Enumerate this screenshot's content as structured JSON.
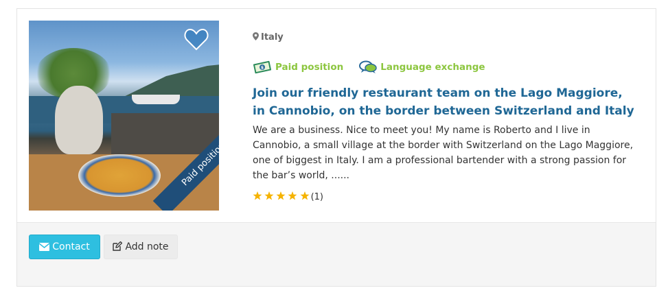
{
  "listing": {
    "location": "Italy",
    "badges": [
      {
        "label": "Paid position",
        "icon": "money-icon"
      },
      {
        "label": "Language exchange",
        "icon": "chat-bubbles-icon"
      }
    ],
    "title": "Join our friendly restaurant team on the Lago Maggiore, in Cannobio, on the border between Switzerland and Italy",
    "description": "We are a business. Nice to meet you! My name is Roberto and I live in Cannobio, a small village at the border with Switzerland on the Lago Maggiore, one of biggest in Italy. I am a professional bartender with a strong passion for the bar’s world, ......",
    "rating": {
      "stars": 5,
      "count": "(1)"
    },
    "ribbon": "Paid position",
    "favorite_icon": "heart-icon",
    "photo": "listing-photo"
  },
  "actions": {
    "contact_label": "Contact",
    "note_label": "Add note"
  },
  "colors": {
    "title": "#1f6795",
    "badge": "#8cc63f",
    "contact_button": "#2ebfe0",
    "ribbon": "#1f4e79",
    "star": "#f5b301"
  }
}
